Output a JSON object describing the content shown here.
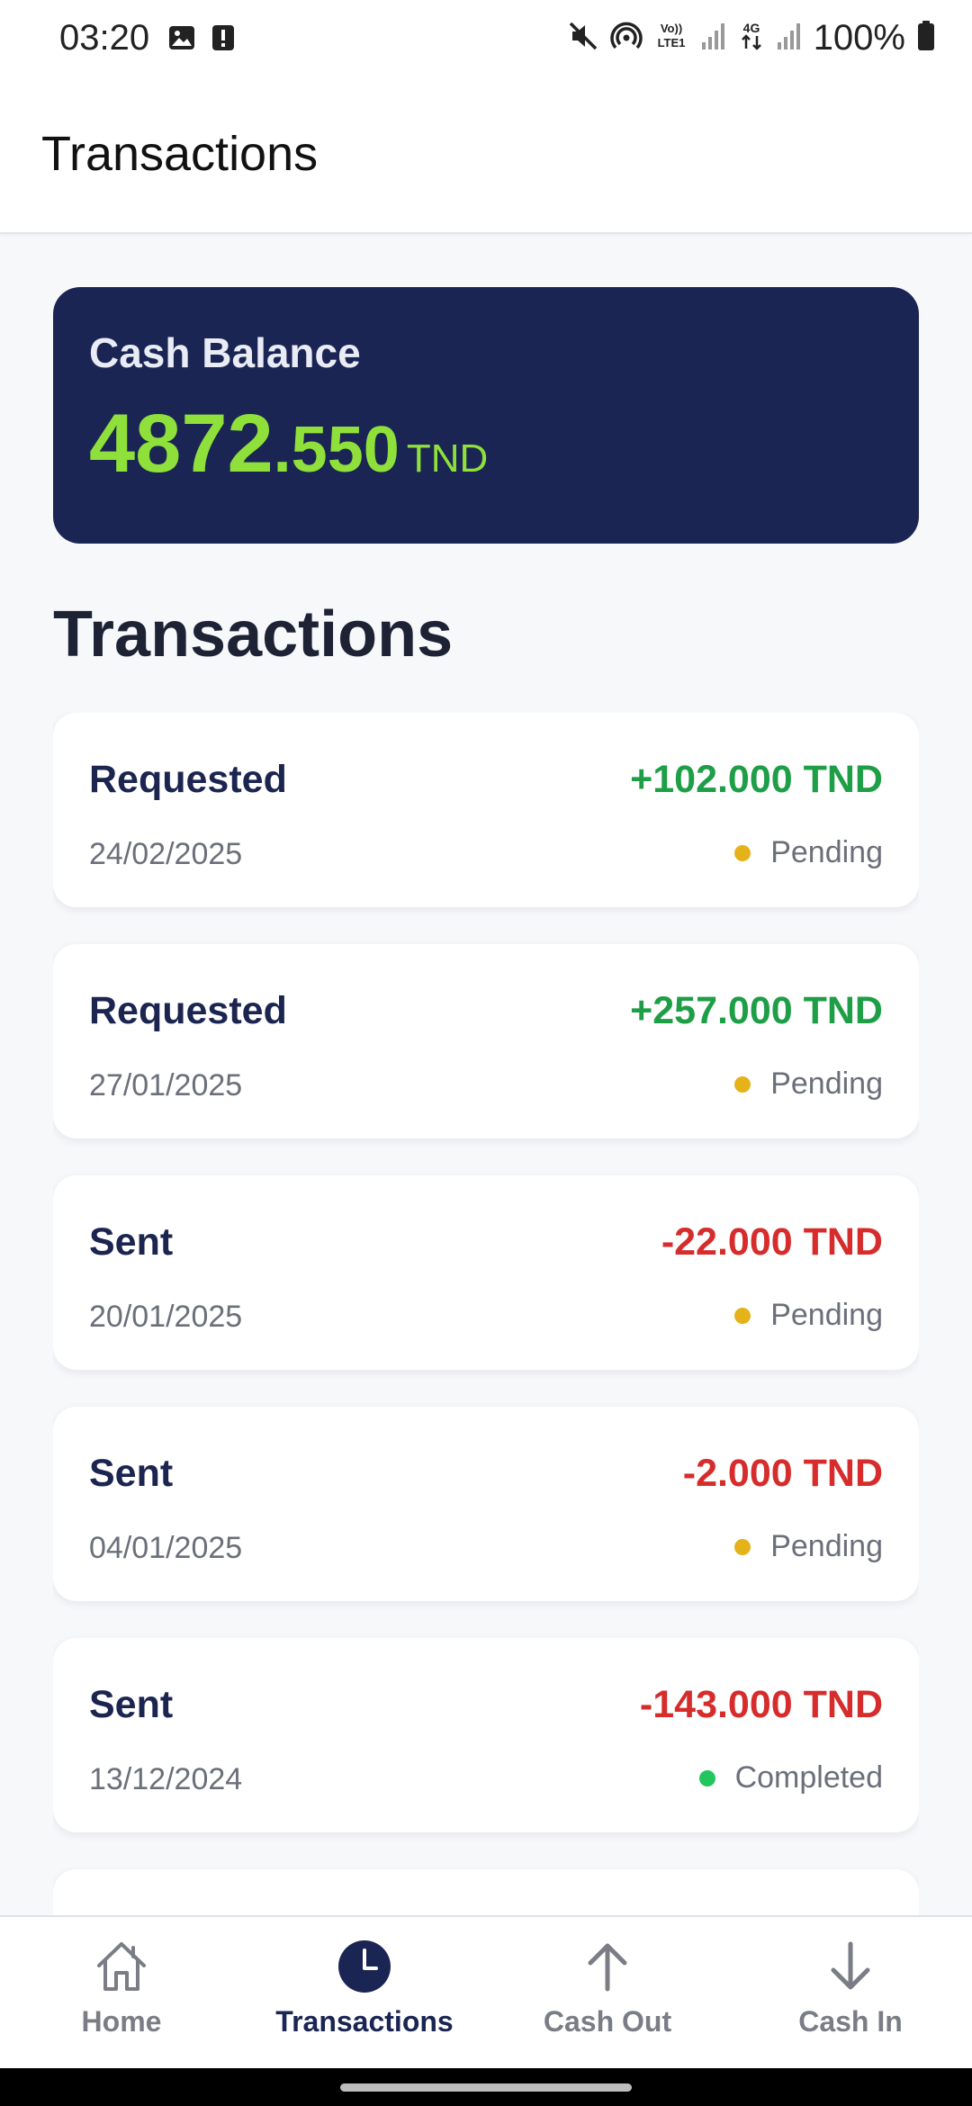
{
  "status_bar": {
    "time": "03:20",
    "network_label": "VoLTE1",
    "network_type": "4G",
    "battery": "100%",
    "left_icons": [
      "image-icon",
      "alert-icon"
    ],
    "right_icons": [
      "mute-icon",
      "hotspot-icon",
      "volte-icon",
      "signal-icon",
      "4g-icon",
      "signal-icon",
      "battery-icon"
    ]
  },
  "app_bar": {
    "title": "Transactions"
  },
  "balance": {
    "label": "Cash Balance",
    "integer": "4872",
    "decimal": ".550",
    "currency": "TND",
    "accent_color": "#8fe03a",
    "card_color": "#1a2554"
  },
  "section_title": "Transactions",
  "transactions": [
    {
      "type": "Requested",
      "amount": "+102.000 TND",
      "date": "24/02/2025",
      "status": "Pending"
    },
    {
      "type": "Requested",
      "amount": "+257.000 TND",
      "date": "27/01/2025",
      "status": "Pending"
    },
    {
      "type": "Sent",
      "amount": "-22.000 TND",
      "date": "20/01/2025",
      "status": "Pending"
    },
    {
      "type": "Sent",
      "amount": "-2.000 TND",
      "date": "04/01/2025",
      "status": "Pending"
    },
    {
      "type": "Sent",
      "amount": "-143.000 TND",
      "date": "13/12/2024",
      "status": "Completed"
    }
  ],
  "colors": {
    "positive": "#1e9e46",
    "negative": "#d62c2c",
    "pending": "#e5b21a",
    "completed": "#22c55e"
  },
  "nav": {
    "items": [
      {
        "label": "Home",
        "icon": "home-icon",
        "active": false
      },
      {
        "label": "Transactions",
        "icon": "clock-icon",
        "active": true
      },
      {
        "label": "Cash Out",
        "icon": "arrow-up-icon",
        "active": false
      },
      {
        "label": "Cash In",
        "icon": "arrow-down-icon",
        "active": false
      }
    ]
  }
}
